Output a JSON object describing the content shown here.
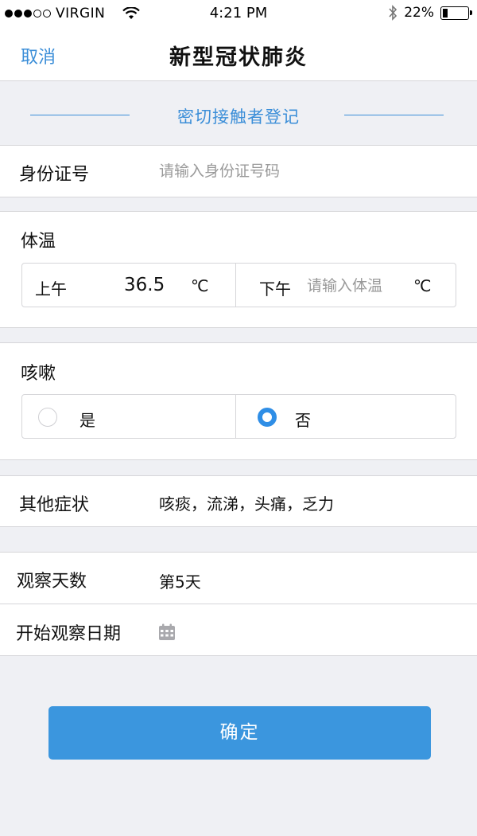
{
  "status_bar": {
    "carrier": "VIRGIN",
    "time": "4:21 PM",
    "battery": "22%",
    "battery_level": 0.22
  },
  "nav": {
    "cancel_label": "取消",
    "title": "新型冠状肺炎"
  },
  "section": {
    "title": "密切接触者登记"
  },
  "id_row": {
    "label": "身份证号",
    "placeholder": "请输入身份证号码",
    "value": ""
  },
  "temperature": {
    "label": "体温",
    "morning_label": "上午",
    "morning_value": "36.5",
    "morning_unit": "℃",
    "afternoon_label": "下午",
    "afternoon_placeholder": "请输入体温",
    "afternoon_unit": "℃"
  },
  "cough": {
    "label": "咳嗽",
    "option_yes": "是",
    "option_no": "否",
    "selected": "否"
  },
  "other_symptoms": {
    "label": "其他症状",
    "value": "咳痰，流涕，头痛，乏力"
  },
  "observation": {
    "days_label": "观察天数",
    "days_value": "第5天",
    "start_date_label": "开始观察日期",
    "calendar_icon": "calendar-icon"
  },
  "confirm_label": "确定",
  "colors": {
    "accent": "#3b8ed8",
    "button": "#3b96de",
    "background": "#eff0f4"
  }
}
